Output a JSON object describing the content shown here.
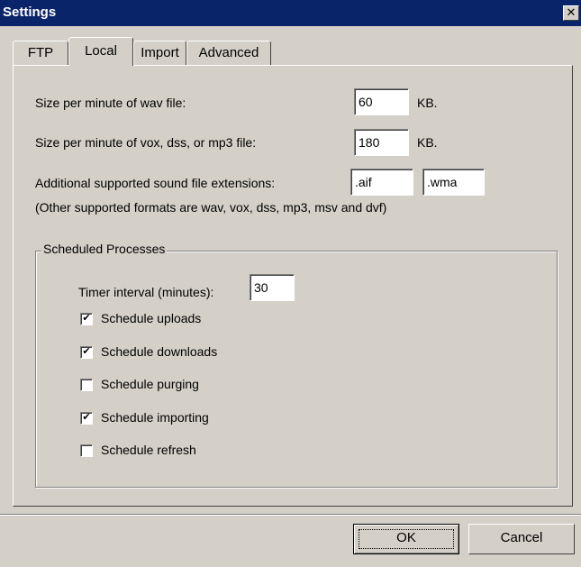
{
  "window": {
    "title": "Settings",
    "close_glyph": "✕"
  },
  "tabs": [
    {
      "label": "FTP",
      "active": false
    },
    {
      "label": "Local",
      "active": true
    },
    {
      "label": "Import",
      "active": false
    },
    {
      "label": "Advanced",
      "active": false
    }
  ],
  "local": {
    "wav_size_label": "Size per minute of wav file:",
    "wav_size_value": "60",
    "wav_size_unit": "KB.",
    "vox_size_label": "Size per minute of vox, dss, or mp3 file:",
    "vox_size_value": "180",
    "vox_size_unit": "KB.",
    "extensions_label": "Additional supported sound file extensions:",
    "extension_1": ".aif",
    "extension_2": ".wma",
    "formats_note": "(Other supported formats are wav, vox, dss, mp3, msv and dvf)"
  },
  "scheduled": {
    "group_title": "Scheduled Processes",
    "timer_label": "Timer interval (minutes):",
    "timer_value": "30",
    "options": [
      {
        "label": "Schedule uploads",
        "checked": true
      },
      {
        "label": "Schedule downloads",
        "checked": true
      },
      {
        "label": "Schedule purging",
        "checked": false
      },
      {
        "label": "Schedule importing",
        "checked": true
      },
      {
        "label": "Schedule refresh",
        "checked": false
      }
    ]
  },
  "buttons": {
    "ok": "OK",
    "cancel": "Cancel"
  }
}
